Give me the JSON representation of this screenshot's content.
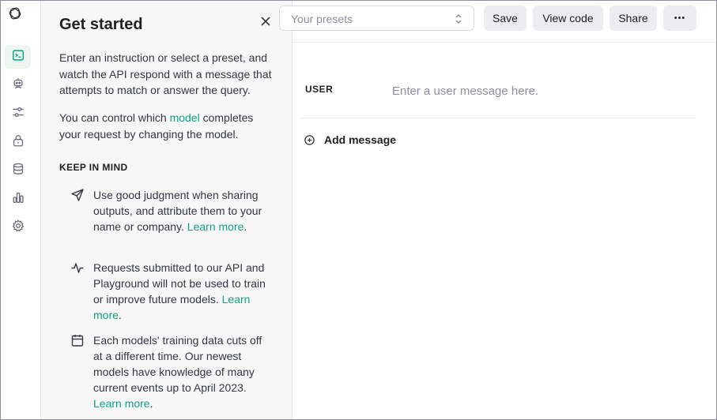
{
  "sidebar": {
    "icons": [
      "openai-logo-icon",
      "terminal-icon",
      "assistant-robot-icon",
      "sliders-icon",
      "lock-icon",
      "database-icon",
      "bar-chart-icon",
      "gear-icon"
    ]
  },
  "panel": {
    "title": "Get started",
    "intro": "Enter an instruction or select a preset, and watch the API respond with a message that attempts to match or answer the query.",
    "model_prefix": "You can control which ",
    "model_link": "model",
    "model_suffix": " completes your request by changing the model.",
    "keep_in_mind": "KEEP IN MIND",
    "tips": [
      {
        "icon": "send-icon",
        "text": "Use good judgment when sharing outputs, and attribute them to your name or company. ",
        "link": "Learn more",
        "end": "."
      },
      {
        "icon": "activity-icon",
        "text": "Requests submitted to our API and Playground will not be used to train or improve future models. ",
        "link": "Learn more",
        "end": "."
      },
      {
        "icon": "calendar-icon",
        "text": "Each models' training data cuts off at a different time. Our newest models have knowledge of many current events up to April 2023. ",
        "link": "Learn more",
        "end": "."
      }
    ]
  },
  "toolbar": {
    "preset_placeholder": "Your presets",
    "save_label": "Save",
    "view_code_label": "View code",
    "share_label": "Share",
    "more_label": "•••"
  },
  "chat": {
    "role_label": "USER",
    "message_placeholder": "Enter a user message here.",
    "add_message_label": "Add message"
  },
  "colors": {
    "accent": "#10a37f",
    "active_nav_bg": "#ecf7f2",
    "panel_bg": "#f7f7f8",
    "button_bg": "#ececf1"
  }
}
